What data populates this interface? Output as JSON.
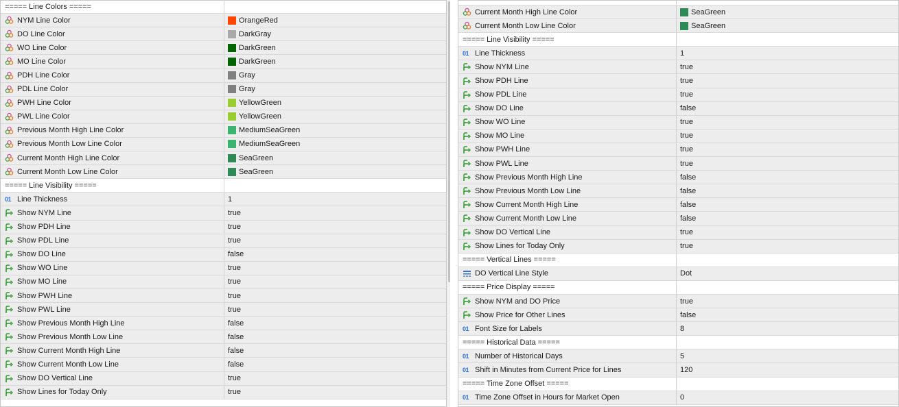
{
  "left_panel": {
    "rows": [
      {
        "type": "header",
        "name": "===== Line Colors =====",
        "value": ""
      },
      {
        "type": "color",
        "name": "NYM Line Color",
        "value": "OrangeRed",
        "color": "#ff4500"
      },
      {
        "type": "color",
        "name": "DO Line Color",
        "value": "DarkGray",
        "color": "#a9a9a9"
      },
      {
        "type": "color",
        "name": "WO Line Color",
        "value": "DarkGreen",
        "color": "#006400"
      },
      {
        "type": "color",
        "name": "MO Line Color",
        "value": "DarkGreen",
        "color": "#006400"
      },
      {
        "type": "color",
        "name": "PDH Line Color",
        "value": "Gray",
        "color": "#808080"
      },
      {
        "type": "color",
        "name": "PDL Line Color",
        "value": "Gray",
        "color": "#808080"
      },
      {
        "type": "color",
        "name": "PWH Line Color",
        "value": "YellowGreen",
        "color": "#9acd32"
      },
      {
        "type": "color",
        "name": "PWL Line Color",
        "value": "YellowGreen",
        "color": "#9acd32"
      },
      {
        "type": "color",
        "name": "Previous Month High Line Color",
        "value": "MediumSeaGreen",
        "color": "#3cb371"
      },
      {
        "type": "color",
        "name": "Previous Month Low Line Color",
        "value": "MediumSeaGreen",
        "color": "#3cb371"
      },
      {
        "type": "color",
        "name": "Current Month High Line Color",
        "value": "SeaGreen",
        "color": "#2e8b57"
      },
      {
        "type": "color",
        "name": "Current Month Low Line Color",
        "value": "SeaGreen",
        "color": "#2e8b57"
      },
      {
        "type": "header",
        "name": "===== Line Visibility =====",
        "value": ""
      },
      {
        "type": "int",
        "name": "Line Thickness",
        "value": "1"
      },
      {
        "type": "bool",
        "name": "Show NYM Line",
        "value": "true"
      },
      {
        "type": "bool",
        "name": "Show PDH Line",
        "value": "true"
      },
      {
        "type": "bool",
        "name": "Show PDL Line",
        "value": "true"
      },
      {
        "type": "bool",
        "name": "Show DO Line",
        "value": "false"
      },
      {
        "type": "bool",
        "name": "Show WO Line",
        "value": "true"
      },
      {
        "type": "bool",
        "name": "Show MO Line",
        "value": "true"
      },
      {
        "type": "bool",
        "name": "Show PWH Line",
        "value": "true"
      },
      {
        "type": "bool",
        "name": "Show PWL Line",
        "value": "true"
      },
      {
        "type": "bool",
        "name": "Show Previous Month High Line",
        "value": "false"
      },
      {
        "type": "bool",
        "name": "Show Previous Month Low Line",
        "value": "false"
      },
      {
        "type": "bool",
        "name": "Show Current Month High Line",
        "value": "false"
      },
      {
        "type": "bool",
        "name": "Show Current Month Low Line",
        "value": "false"
      },
      {
        "type": "bool",
        "name": "Show DO Vertical Line",
        "value": "true"
      },
      {
        "type": "bool",
        "name": "Show Lines for Today Only",
        "value": "true"
      }
    ]
  },
  "right_panel": {
    "rows": [
      {
        "type": "color",
        "name": "Current Month High Line Color",
        "value": "SeaGreen",
        "color": "#2e8b57"
      },
      {
        "type": "color",
        "name": "Current Month Low Line Color",
        "value": "SeaGreen",
        "color": "#2e8b57"
      },
      {
        "type": "header",
        "name": "===== Line Visibility =====",
        "value": ""
      },
      {
        "type": "int",
        "name": "Line Thickness",
        "value": "1"
      },
      {
        "type": "bool",
        "name": "Show NYM Line",
        "value": "true"
      },
      {
        "type": "bool",
        "name": "Show PDH Line",
        "value": "true"
      },
      {
        "type": "bool",
        "name": "Show PDL Line",
        "value": "true"
      },
      {
        "type": "bool",
        "name": "Show DO Line",
        "value": "false"
      },
      {
        "type": "bool",
        "name": "Show WO Line",
        "value": "true"
      },
      {
        "type": "bool",
        "name": "Show MO Line",
        "value": "true"
      },
      {
        "type": "bool",
        "name": "Show PWH Line",
        "value": "true"
      },
      {
        "type": "bool",
        "name": "Show PWL Line",
        "value": "true"
      },
      {
        "type": "bool",
        "name": "Show Previous Month High Line",
        "value": "false"
      },
      {
        "type": "bool",
        "name": "Show Previous Month Low Line",
        "value": "false"
      },
      {
        "type": "bool",
        "name": "Show Current Month High Line",
        "value": "false"
      },
      {
        "type": "bool",
        "name": "Show Current Month Low Line",
        "value": "false"
      },
      {
        "type": "bool",
        "name": "Show DO Vertical Line",
        "value": "true"
      },
      {
        "type": "bool",
        "name": "Show Lines for Today Only",
        "value": "true"
      },
      {
        "type": "header",
        "name": "===== Vertical Lines =====",
        "value": ""
      },
      {
        "type": "enum",
        "name": "DO Vertical Line Style",
        "value": "Dot"
      },
      {
        "type": "header",
        "name": "===== Price Display =====",
        "value": ""
      },
      {
        "type": "bool",
        "name": "Show NYM and DO Price",
        "value": "true"
      },
      {
        "type": "bool",
        "name": "Show Price for Other Lines",
        "value": "false"
      },
      {
        "type": "int",
        "name": "Font Size for Labels",
        "value": "8"
      },
      {
        "type": "header",
        "name": "===== Historical Data =====",
        "value": ""
      },
      {
        "type": "int",
        "name": "Number of Historical Days",
        "value": "5"
      },
      {
        "type": "int",
        "name": "Shift in Minutes from Current Price for Lines",
        "value": "120"
      },
      {
        "type": "header",
        "name": "===== Time Zone Offset =====",
        "value": ""
      },
      {
        "type": "int",
        "name": "Time Zone Offset in Hours for Market Open",
        "value": "0"
      }
    ]
  },
  "icons": {
    "int": "01",
    "color": "color-palette-icon",
    "bool": "arrow-toggle-icon",
    "enum": "line-style-icon"
  }
}
